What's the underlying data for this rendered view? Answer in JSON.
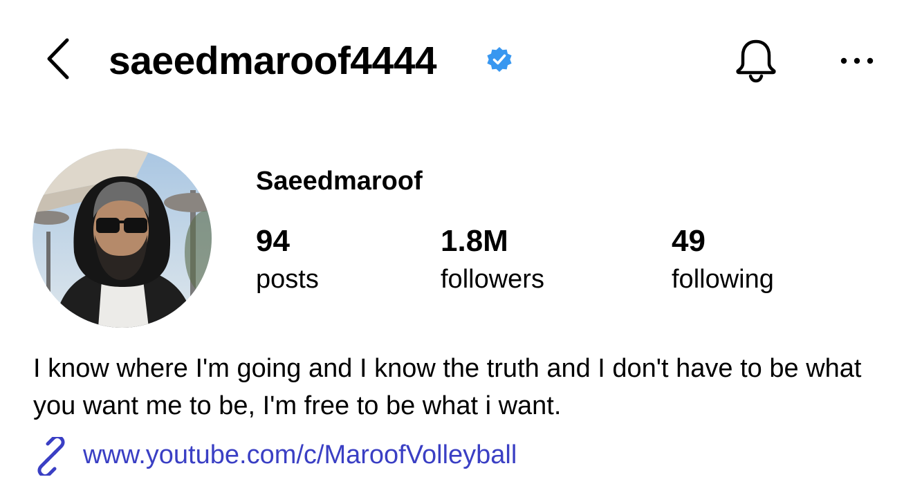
{
  "header": {
    "username": "saeedmaroof4444",
    "verified_icon": "verified-badge-icon",
    "verified_color": "#3897f0",
    "back_icon": "chevron-left-icon",
    "bell_icon": "bell-icon",
    "more_icon": "ellipsis-icon"
  },
  "profile": {
    "display_name": "Saeedmaroof",
    "stats": [
      {
        "value": "94",
        "label": "posts"
      },
      {
        "value": "1.8M",
        "label": "followers"
      },
      {
        "value": "49",
        "label": "following"
      }
    ],
    "bio": "I know where I'm going and I know the truth and I don't have to be what you want me to be, I'm free to be what i want.",
    "link": {
      "text": "www.youtube.com/c/MaroofVolleyball",
      "icon": "link-icon",
      "color": "#3a3fc4"
    }
  }
}
